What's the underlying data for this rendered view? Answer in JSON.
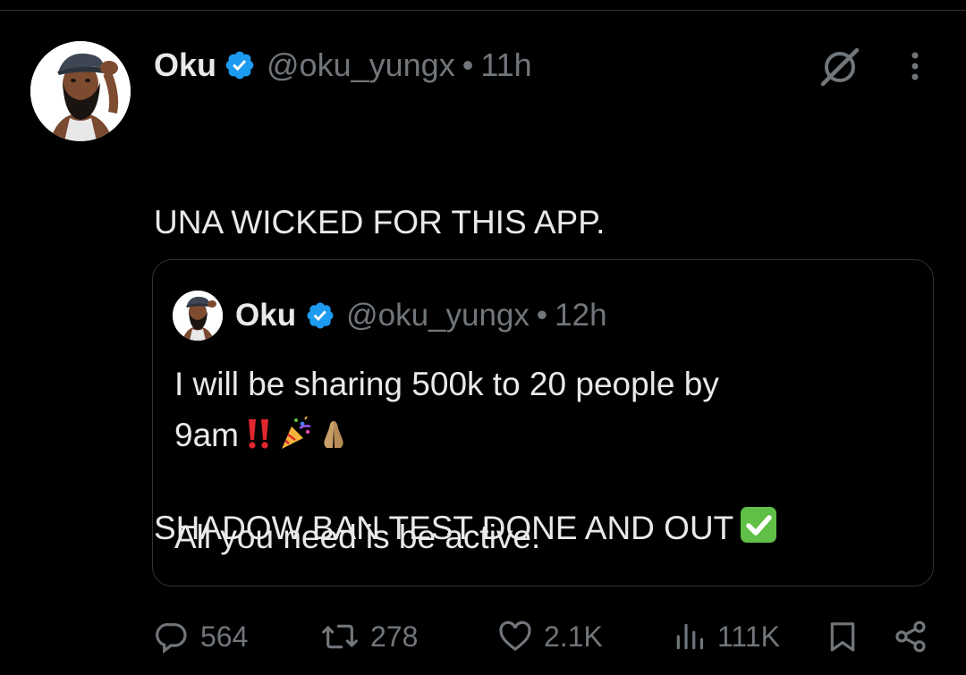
{
  "tweet": {
    "author_name": "Oku",
    "handle": "@oku_yungx",
    "separator": "•",
    "time": "11h",
    "text_line1": "UNA WICKED FOR THIS APP.",
    "text_line2": "",
    "text_line3": "SHADOW BAN TEST DONE AND OUT",
    "emoji_check": "check-mark-button-emoji"
  },
  "quote": {
    "author_name": "Oku",
    "handle": "@oku_yungx",
    "separator": "•",
    "time": "12h",
    "text_line1": "I will be sharing 500k to 20 people by",
    "text_line2_prefix": "9am",
    "text_line3": "",
    "text_line4": "All you need is be active.",
    "emojis": [
      "double-exclamation-emoji",
      "party-popper-emoji",
      "folded-hands-emoji"
    ]
  },
  "actions": {
    "replies": "564",
    "reposts": "278",
    "likes": "2.1K",
    "views": "111K"
  },
  "colors": {
    "background": "#000000",
    "text": "#e7e9ea",
    "secondary": "#71767b",
    "verified_blue": "#1d9bf0",
    "border": "#2f3336"
  },
  "icons": [
    "verified-badge-icon",
    "grok-icon",
    "more-icon",
    "reply-icon",
    "repost-icon",
    "like-icon",
    "views-icon",
    "bookmark-icon",
    "share-icon"
  ]
}
